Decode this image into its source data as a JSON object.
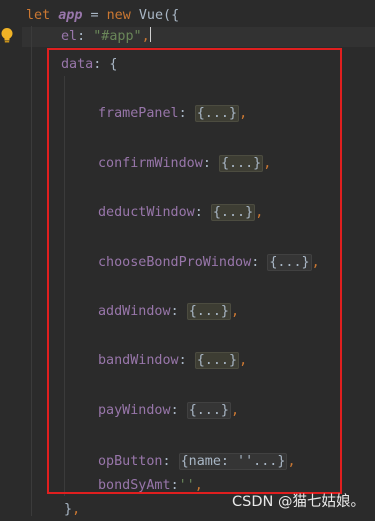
{
  "code": {
    "l1": {
      "kw_let": "let",
      "var_app": "app",
      "eq": " = ",
      "kw_new": "new",
      "vue": " Vue({"
    },
    "l2": {
      "key": "el",
      "colon": ": ",
      "value": "\"#app\"",
      "comma": ","
    },
    "l3": {
      "key": "data",
      "rest": ": {"
    },
    "props": [
      {
        "key": "framePanel",
        "colon": ": ",
        "fold": "{...}",
        "comma": ","
      },
      {
        "key": "confirmWindow",
        "colon": ": ",
        "fold": "{...}",
        "comma": ","
      },
      {
        "key": "deductWindow",
        "colon": ": ",
        "fold": "{...}",
        "comma": ","
      },
      {
        "key": "chooseBondProWindow",
        "colon": ": ",
        "fold": "{...}",
        "comma": ","
      },
      {
        "key": "addWindow",
        "colon": ": ",
        "fold": "{...}",
        "comma": ","
      },
      {
        "key": "bandWindow",
        "colon": ": ",
        "fold": "{...}",
        "comma": ","
      },
      {
        "key": "payWindow",
        "colon": ": ",
        "fold": "{...}",
        "comma": ","
      },
      {
        "key": "opButton",
        "colon": ": ",
        "fold": "{name: ''...}",
        "comma": ","
      },
      {
        "key": "bondSyAmt",
        "colon": ":",
        "value": "''",
        "comma": ","
      }
    ],
    "close": {
      "text": "}",
      "comma": ","
    }
  },
  "colors": {
    "background": "#2b2b2b",
    "keyword": "#cc7832",
    "property": "#9876aa",
    "string": "#6a8759",
    "text": "#a9b7c6",
    "highlight_box": "#e01f1f"
  },
  "icons": {
    "gutter_hint": "lightbulb-icon"
  },
  "watermark": "CSDN @猫七姑娘。"
}
